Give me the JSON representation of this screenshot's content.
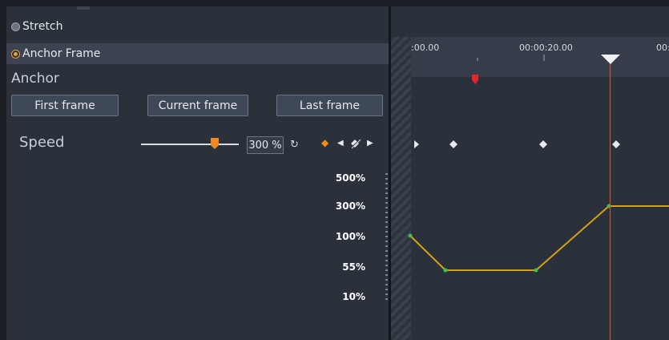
{
  "options": {
    "stretch_label": "Stretch",
    "anchor_frame_label": "Anchor Frame",
    "selected": "anchor_frame"
  },
  "anchor": {
    "title": "Anchor",
    "first_frame": "First frame",
    "current_frame": "Current frame",
    "last_frame": "Last frame"
  },
  "speed": {
    "label": "Speed",
    "value_text": "300 %",
    "slider_value": 0.75
  },
  "graph": {
    "y_labels": [
      "500%",
      "300%",
      "100%",
      "55%",
      "10%"
    ],
    "line_color": "#d4a017",
    "point_color": "#3cc24a"
  },
  "timeline": {
    "time_labels": [
      ":00.00",
      "00:00:20.00",
      "00:0"
    ],
    "playhead_color": "#e0552c"
  },
  "icons": {
    "reset": "reset-icon",
    "add_keyframe": "diamond-icon",
    "prev_keyframe": "triangle-left-icon",
    "remove_keyframe": "remove-keyframe-icon",
    "next_keyframe": "triangle-right-icon"
  }
}
